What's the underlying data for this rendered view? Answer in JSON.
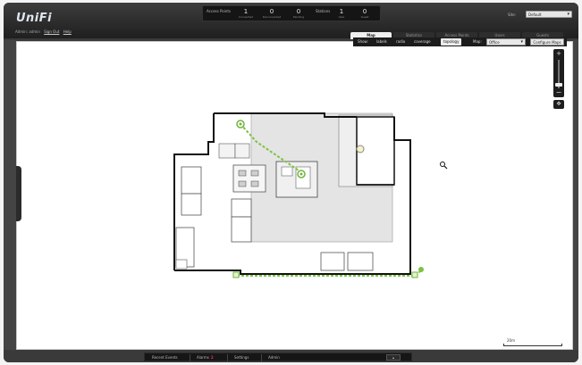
{
  "app": {
    "logo": "UniFi",
    "user_line": [
      "Admin: admin",
      "Sign Out",
      "Help"
    ]
  },
  "stats": {
    "access_points": {
      "title": "Access Points",
      "items": [
        {
          "num": "1",
          "label": "Connected"
        },
        {
          "num": "0",
          "label": "Disconnected"
        },
        {
          "num": "0",
          "label": "Pending"
        }
      ]
    },
    "stations": {
      "title": "Stations",
      "items": [
        {
          "num": "1",
          "label": "User"
        },
        {
          "num": "0",
          "label": "Guest"
        }
      ]
    }
  },
  "site": {
    "label": "Site:",
    "value": "Default"
  },
  "tabs": [
    {
      "label": "Map",
      "active": true
    },
    {
      "label": "Statistics",
      "active": false
    },
    {
      "label": "Access Points",
      "active": false
    },
    {
      "label": "Users",
      "active": false
    },
    {
      "label": "Guests",
      "active": false
    }
  ],
  "toolbar": {
    "items": [
      {
        "label": "Show:",
        "active": false
      },
      {
        "label": "labels",
        "active": false
      },
      {
        "label": "radio",
        "active": false
      },
      {
        "label": "coverage",
        "active": false
      },
      {
        "label": "topology",
        "active": true
      }
    ],
    "map_label": "Map:",
    "map_value": "Office",
    "configure_maps": "Configure Maps"
  },
  "zoom": {
    "plus": "+",
    "minus": "−",
    "level": 0.2
  },
  "scale": {
    "label": "20m"
  },
  "bottom": {
    "alerts_label": "Recent Events",
    "alarms_label": "Alarms",
    "alarms_count": "2",
    "settings_label": "Settings",
    "admin_label": "Admin"
  },
  "icons": {
    "pan": "move-icon",
    "cursor": "magnifier-cursor-icon",
    "ap": "access-point-icon"
  },
  "colors": {
    "topology_link": "#7cc242",
    "ap_ring": "#6fb43a",
    "room_fill": "#e4e4e4",
    "wall": "#111111",
    "alarm": "#e33344"
  }
}
